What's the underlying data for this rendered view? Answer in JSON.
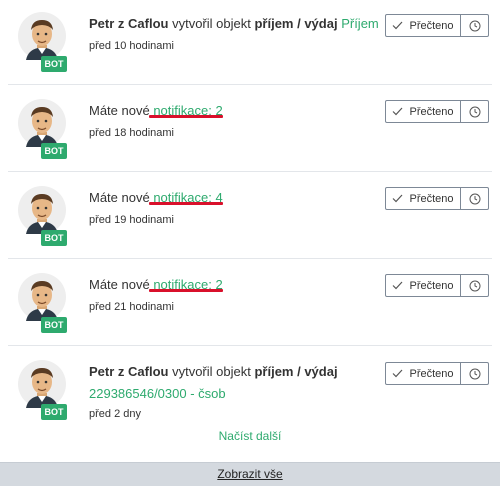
{
  "notifications": [
    {
      "bot_badge": "BOT",
      "author": "Petr z Caflou",
      "action": "vytvořil objekt",
      "object_type": "příjem / výdaj",
      "object_name": "Příjem",
      "time": "před 10 hodinami",
      "read_label": "Přečteno"
    },
    {
      "bot_badge": "BOT",
      "prefix": "Máte nové",
      "link": "notifikace: 2",
      "time": "před 18 hodinami",
      "read_label": "Přečteno"
    },
    {
      "bot_badge": "BOT",
      "prefix": "Máte nové",
      "link": "notifikace: 4",
      "time": "před 19 hodinami",
      "read_label": "Přečteno"
    },
    {
      "bot_badge": "BOT",
      "prefix": "Máte nové",
      "link": "notifikace: 2",
      "time": "před 21 hodinami",
      "read_label": "Přečteno"
    },
    {
      "bot_badge": "BOT",
      "author": "Petr z Caflou",
      "action": "vytvořil objekt",
      "object_type": "příjem / výdaj",
      "object_name": "229386546/0300 - čsob",
      "time": "před 2 dny",
      "read_label": "Přečteno"
    }
  ],
  "load_more": "Načíst další",
  "footer_link": "Zobrazit vše",
  "colors": {
    "accent_green": "#2eaa6e",
    "underline_red": "#d9102b",
    "footer_bg": "#d4d9df"
  },
  "icons": {
    "read": "check-icon",
    "snooze": "clock-icon",
    "avatar": "bot-avatar-icon"
  }
}
